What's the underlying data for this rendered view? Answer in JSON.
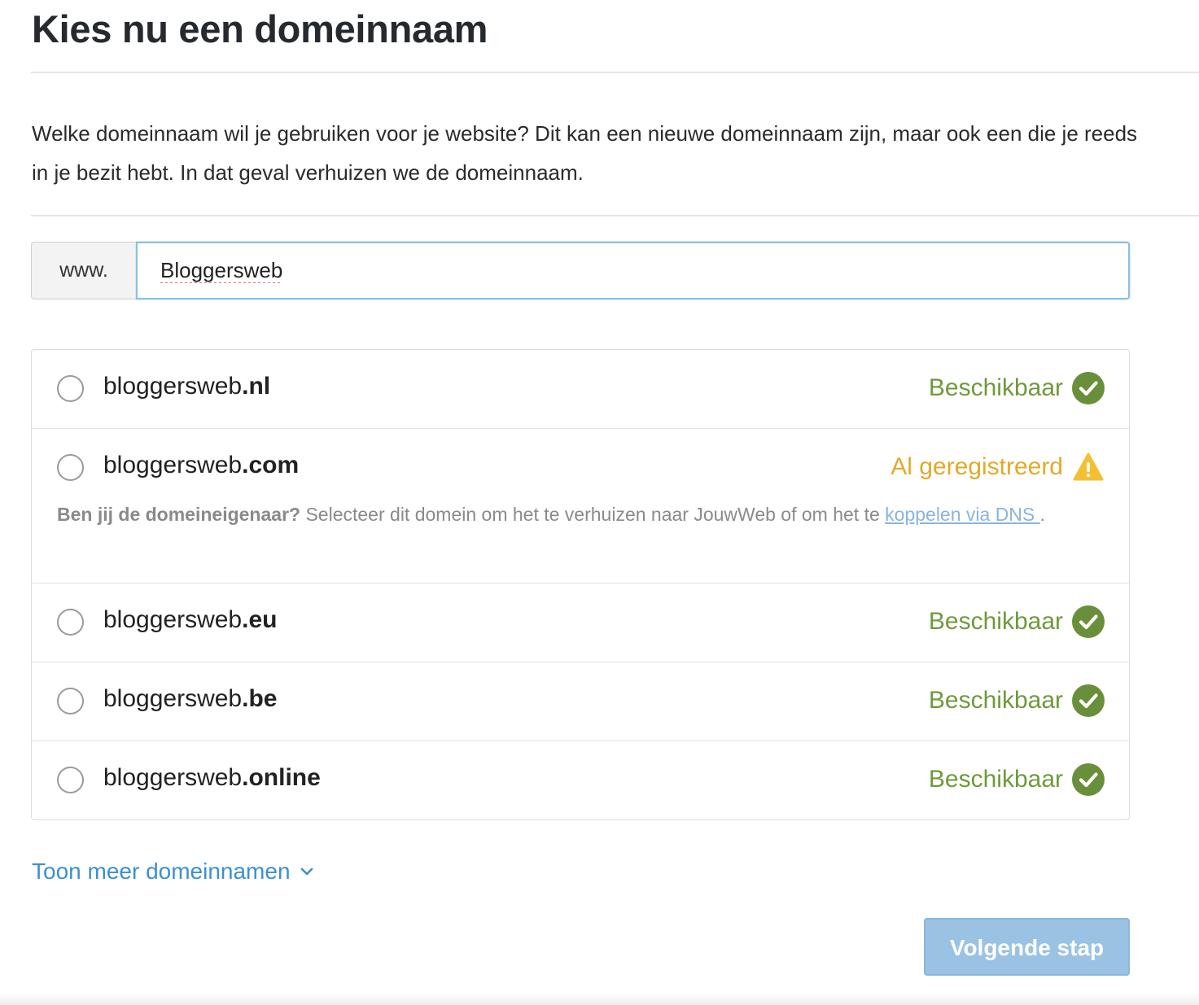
{
  "page": {
    "title": "Kies nu een domeinnaam",
    "intro": "Welke domeinnaam wil je gebruiken voor je website? Dit kan een nieuwe domeinnaam zijn, maar ook een die je reeds in je bezit hebt. In dat geval verhuizen we de domeinnaam."
  },
  "domain_input": {
    "prefix": "www.",
    "value": "Bloggersweb"
  },
  "domains": [
    {
      "base": "bloggersweb",
      "tld": ".nl",
      "status": "Beschikbaar",
      "state": "available"
    },
    {
      "base": "bloggersweb",
      "tld": ".com",
      "status": "Al geregistreerd",
      "state": "taken"
    },
    {
      "base": "bloggersweb",
      "tld": ".eu",
      "status": "Beschikbaar",
      "state": "available"
    },
    {
      "base": "bloggersweb",
      "tld": ".be",
      "status": "Beschikbaar",
      "state": "available"
    },
    {
      "base": "bloggersweb",
      "tld": ".online",
      "status": "Beschikbaar",
      "state": "available"
    }
  ],
  "owner_note": {
    "question": "Ben jij de domeineigenaar?",
    "text": " Selecteer dit domein om het te verhuizen naar JouwWeb of om het te ",
    "link": "koppelen via DNS ",
    "end": "."
  },
  "show_more": {
    "label": "Toon meer domeinnamen",
    "icon": "chevron-down-icon"
  },
  "next_button": {
    "label": "Volgende stap",
    "enabled": false
  },
  "colors": {
    "available": "#6e9a3a",
    "taken": "#e2aa2a",
    "link": "#3d8fd0",
    "button": "#9ac2e3",
    "input_focus": "#8cbfe5"
  }
}
